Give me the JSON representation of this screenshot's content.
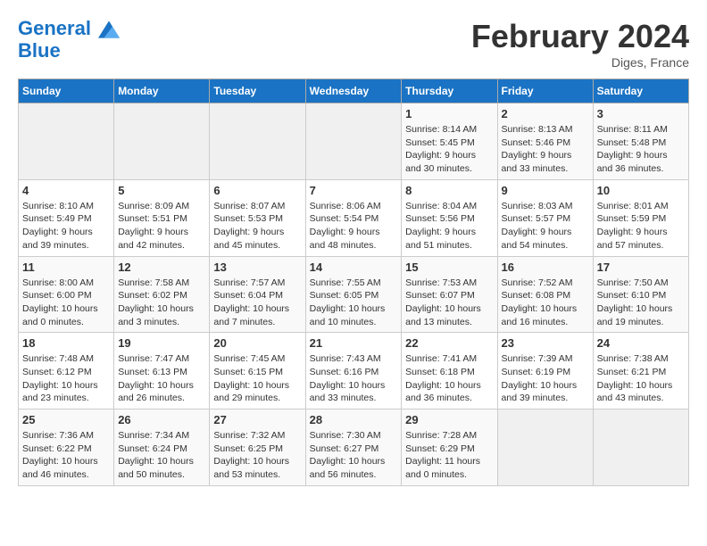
{
  "header": {
    "logo_line1": "General",
    "logo_line2": "Blue",
    "month": "February 2024",
    "location": "Diges, France"
  },
  "weekdays": [
    "Sunday",
    "Monday",
    "Tuesday",
    "Wednesday",
    "Thursday",
    "Friday",
    "Saturday"
  ],
  "weeks": [
    [
      {
        "day": "",
        "sunrise": "",
        "sunset": "",
        "daylight": ""
      },
      {
        "day": "",
        "sunrise": "",
        "sunset": "",
        "daylight": ""
      },
      {
        "day": "",
        "sunrise": "",
        "sunset": "",
        "daylight": ""
      },
      {
        "day": "",
        "sunrise": "",
        "sunset": "",
        "daylight": ""
      },
      {
        "day": "1",
        "sunrise": "Sunrise: 8:14 AM",
        "sunset": "Sunset: 5:45 PM",
        "daylight": "Daylight: 9 hours and 30 minutes."
      },
      {
        "day": "2",
        "sunrise": "Sunrise: 8:13 AM",
        "sunset": "Sunset: 5:46 PM",
        "daylight": "Daylight: 9 hours and 33 minutes."
      },
      {
        "day": "3",
        "sunrise": "Sunrise: 8:11 AM",
        "sunset": "Sunset: 5:48 PM",
        "daylight": "Daylight: 9 hours and 36 minutes."
      }
    ],
    [
      {
        "day": "4",
        "sunrise": "Sunrise: 8:10 AM",
        "sunset": "Sunset: 5:49 PM",
        "daylight": "Daylight: 9 hours and 39 minutes."
      },
      {
        "day": "5",
        "sunrise": "Sunrise: 8:09 AM",
        "sunset": "Sunset: 5:51 PM",
        "daylight": "Daylight: 9 hours and 42 minutes."
      },
      {
        "day": "6",
        "sunrise": "Sunrise: 8:07 AM",
        "sunset": "Sunset: 5:53 PM",
        "daylight": "Daylight: 9 hours and 45 minutes."
      },
      {
        "day": "7",
        "sunrise": "Sunrise: 8:06 AM",
        "sunset": "Sunset: 5:54 PM",
        "daylight": "Daylight: 9 hours and 48 minutes."
      },
      {
        "day": "8",
        "sunrise": "Sunrise: 8:04 AM",
        "sunset": "Sunset: 5:56 PM",
        "daylight": "Daylight: 9 hours and 51 minutes."
      },
      {
        "day": "9",
        "sunrise": "Sunrise: 8:03 AM",
        "sunset": "Sunset: 5:57 PM",
        "daylight": "Daylight: 9 hours and 54 minutes."
      },
      {
        "day": "10",
        "sunrise": "Sunrise: 8:01 AM",
        "sunset": "Sunset: 5:59 PM",
        "daylight": "Daylight: 9 hours and 57 minutes."
      }
    ],
    [
      {
        "day": "11",
        "sunrise": "Sunrise: 8:00 AM",
        "sunset": "Sunset: 6:00 PM",
        "daylight": "Daylight: 10 hours and 0 minutes."
      },
      {
        "day": "12",
        "sunrise": "Sunrise: 7:58 AM",
        "sunset": "Sunset: 6:02 PM",
        "daylight": "Daylight: 10 hours and 3 minutes."
      },
      {
        "day": "13",
        "sunrise": "Sunrise: 7:57 AM",
        "sunset": "Sunset: 6:04 PM",
        "daylight": "Daylight: 10 hours and 7 minutes."
      },
      {
        "day": "14",
        "sunrise": "Sunrise: 7:55 AM",
        "sunset": "Sunset: 6:05 PM",
        "daylight": "Daylight: 10 hours and 10 minutes."
      },
      {
        "day": "15",
        "sunrise": "Sunrise: 7:53 AM",
        "sunset": "Sunset: 6:07 PM",
        "daylight": "Daylight: 10 hours and 13 minutes."
      },
      {
        "day": "16",
        "sunrise": "Sunrise: 7:52 AM",
        "sunset": "Sunset: 6:08 PM",
        "daylight": "Daylight: 10 hours and 16 minutes."
      },
      {
        "day": "17",
        "sunrise": "Sunrise: 7:50 AM",
        "sunset": "Sunset: 6:10 PM",
        "daylight": "Daylight: 10 hours and 19 minutes."
      }
    ],
    [
      {
        "day": "18",
        "sunrise": "Sunrise: 7:48 AM",
        "sunset": "Sunset: 6:12 PM",
        "daylight": "Daylight: 10 hours and 23 minutes."
      },
      {
        "day": "19",
        "sunrise": "Sunrise: 7:47 AM",
        "sunset": "Sunset: 6:13 PM",
        "daylight": "Daylight: 10 hours and 26 minutes."
      },
      {
        "day": "20",
        "sunrise": "Sunrise: 7:45 AM",
        "sunset": "Sunset: 6:15 PM",
        "daylight": "Daylight: 10 hours and 29 minutes."
      },
      {
        "day": "21",
        "sunrise": "Sunrise: 7:43 AM",
        "sunset": "Sunset: 6:16 PM",
        "daylight": "Daylight: 10 hours and 33 minutes."
      },
      {
        "day": "22",
        "sunrise": "Sunrise: 7:41 AM",
        "sunset": "Sunset: 6:18 PM",
        "daylight": "Daylight: 10 hours and 36 minutes."
      },
      {
        "day": "23",
        "sunrise": "Sunrise: 7:39 AM",
        "sunset": "Sunset: 6:19 PM",
        "daylight": "Daylight: 10 hours and 39 minutes."
      },
      {
        "day": "24",
        "sunrise": "Sunrise: 7:38 AM",
        "sunset": "Sunset: 6:21 PM",
        "daylight": "Daylight: 10 hours and 43 minutes."
      }
    ],
    [
      {
        "day": "25",
        "sunrise": "Sunrise: 7:36 AM",
        "sunset": "Sunset: 6:22 PM",
        "daylight": "Daylight: 10 hours and 46 minutes."
      },
      {
        "day": "26",
        "sunrise": "Sunrise: 7:34 AM",
        "sunset": "Sunset: 6:24 PM",
        "daylight": "Daylight: 10 hours and 50 minutes."
      },
      {
        "day": "27",
        "sunrise": "Sunrise: 7:32 AM",
        "sunset": "Sunset: 6:25 PM",
        "daylight": "Daylight: 10 hours and 53 minutes."
      },
      {
        "day": "28",
        "sunrise": "Sunrise: 7:30 AM",
        "sunset": "Sunset: 6:27 PM",
        "daylight": "Daylight: 10 hours and 56 minutes."
      },
      {
        "day": "29",
        "sunrise": "Sunrise: 7:28 AM",
        "sunset": "Sunset: 6:29 PM",
        "daylight": "Daylight: 11 hours and 0 minutes."
      },
      {
        "day": "",
        "sunrise": "",
        "sunset": "",
        "daylight": ""
      },
      {
        "day": "",
        "sunrise": "",
        "sunset": "",
        "daylight": ""
      }
    ]
  ]
}
